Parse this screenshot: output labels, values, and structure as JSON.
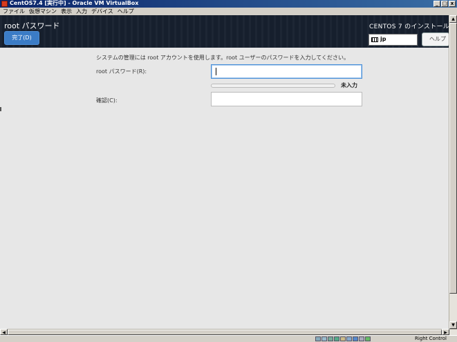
{
  "window": {
    "title": "CentOS7.4 [実行中] - Oracle VM VirtualBox",
    "controls": {
      "minimize": "_",
      "maximize": "□",
      "close": "x"
    }
  },
  "menu": [
    "ファイル",
    "仮想マシン",
    "表示",
    "入力",
    "デバイス",
    "ヘルプ"
  ],
  "installer": {
    "page_title": "root パスワード",
    "done_button": "完了(D)",
    "product_title": "CENTOS 7 のインストール",
    "keyboard_layout": "jp",
    "help_button": "ヘルプ"
  },
  "form": {
    "description": "システムの管理には root アカウントを使用します。root ユーザーのパスワードを入力してください。",
    "password_label": "root パスワード(R):",
    "password_value": "",
    "strength_label": "未入力",
    "strength_fraction": 0,
    "confirm_label": "確認(C):",
    "confirm_value": ""
  },
  "status_bar": {
    "host_key": "Right Control",
    "indicator_icons": [
      "hdd-icon",
      "optical-icon",
      "usb-icon",
      "network-icon",
      "shared-folder-icon",
      "display-icon",
      "capture-icon",
      "mouse-icon",
      "keyboard-icon"
    ]
  },
  "colors": {
    "accent": "#3b7cc6",
    "header_bg": "#161f2d",
    "content_bg": "#e7e7e7",
    "titlebar": "#0a246a"
  }
}
